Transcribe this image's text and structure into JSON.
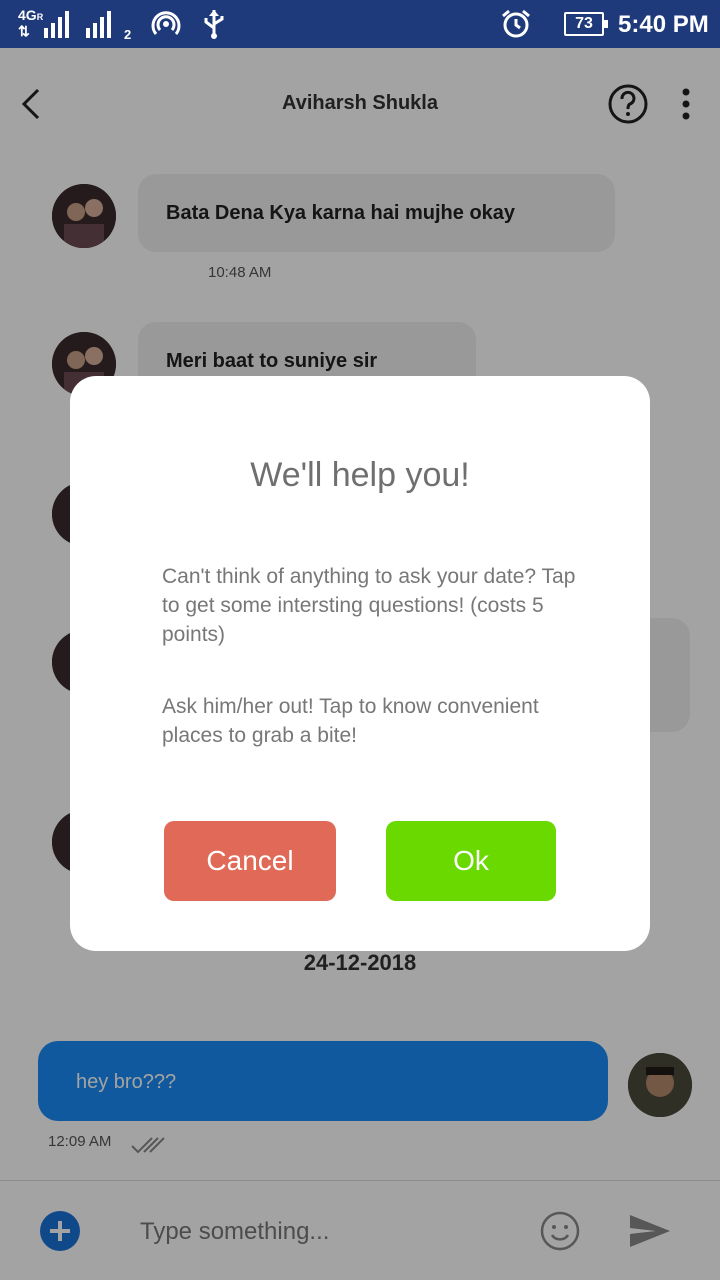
{
  "status_bar": {
    "network": "4G",
    "roaming": "R",
    "sim2_label": "2",
    "battery": "73",
    "time": "5:40 PM"
  },
  "header": {
    "title": "Aviharsh Shukla"
  },
  "messages": [
    {
      "text": "Bata Dena Kya karna hai mujhe okay",
      "time": "10:48 AM"
    },
    {
      "text": "Meri baat to suniye sir"
    }
  ],
  "date_separator": "24-12-2018",
  "outgoing": {
    "text": "hey bro???",
    "time": "12:09 AM"
  },
  "composer": {
    "placeholder": "Type something..."
  },
  "dialog": {
    "title": "We'll help you!",
    "option_questions": "Can't think of anything to ask your date? Tap to get some intersting questions! (costs 5 points)",
    "option_places": "Ask him/her out! Tap to know convenient places to grab a bite!",
    "cancel_label": "Cancel",
    "ok_label": "Ok"
  },
  "colors": {
    "status_bar": "#1f3a7a",
    "outgoing_bubble": "#1a8cf7",
    "cancel": "#e06a57",
    "ok": "#69d900"
  }
}
